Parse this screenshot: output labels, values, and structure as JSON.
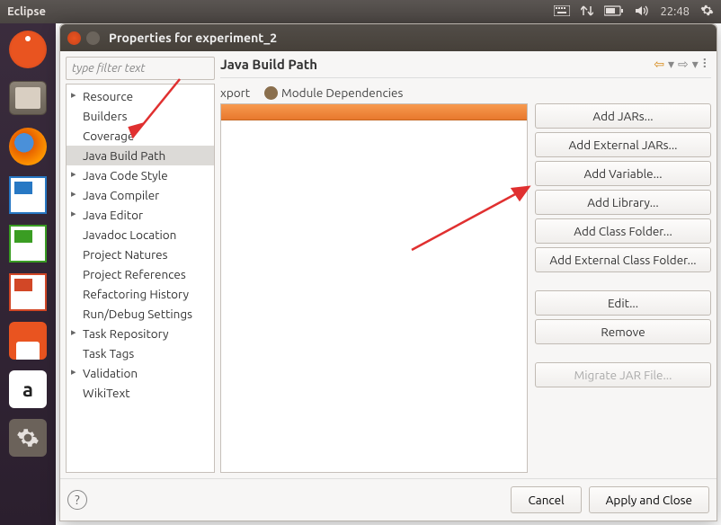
{
  "topbar": {
    "app": "Eclipse",
    "time": "22:48"
  },
  "dialog": {
    "title": "Properties for experiment_2",
    "filter_placeholder": "type filter text",
    "tree": [
      {
        "label": "Resource",
        "expandable": true
      },
      {
        "label": "Builders"
      },
      {
        "label": "Coverage"
      },
      {
        "label": "Java Build Path",
        "selected": true
      },
      {
        "label": "Java Code Style",
        "expandable": true
      },
      {
        "label": "Java Compiler",
        "expandable": true
      },
      {
        "label": "Java Editor",
        "expandable": true
      },
      {
        "label": "Javadoc Location"
      },
      {
        "label": "Project Natures"
      },
      {
        "label": "Project References"
      },
      {
        "label": "Refactoring History"
      },
      {
        "label": "Run/Debug Settings"
      },
      {
        "label": "Task Repository",
        "expandable": true
      },
      {
        "label": "Task Tags"
      },
      {
        "label": "Validation",
        "expandable": true
      },
      {
        "label": "WikiText"
      }
    ],
    "main_title": "Java Build Path",
    "tabs": {
      "xport": "xport",
      "module_deps": "Module Dependencies"
    },
    "buttons": {
      "add_jars": "Add JARs...",
      "add_ext_jars": "Add External JARs...",
      "add_var": "Add Variable...",
      "add_lib": "Add Library...",
      "add_cf": "Add Class Folder...",
      "add_ext_cf": "Add External Class Folder...",
      "edit": "Edit...",
      "remove": "Remove",
      "migrate": "Migrate JAR File..."
    },
    "footer": {
      "cancel": "Cancel",
      "apply_close": "Apply and Close"
    }
  }
}
